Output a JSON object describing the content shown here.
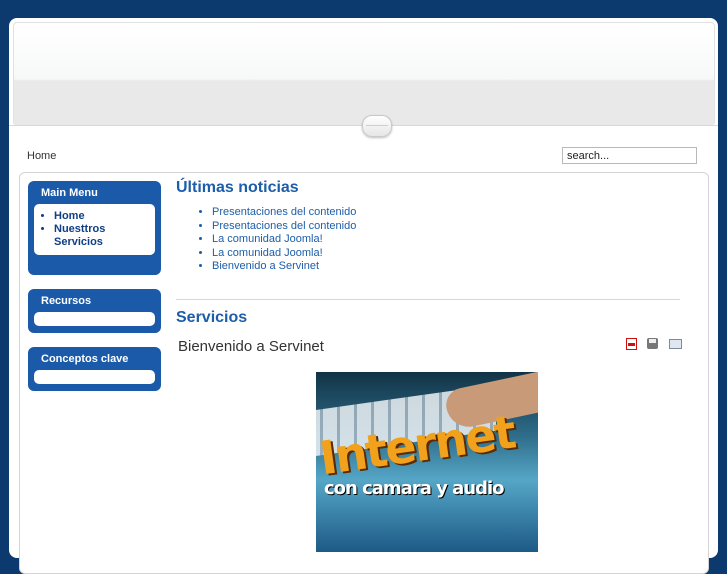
{
  "breadcrumb": "Home",
  "search": {
    "placeholder": "search..."
  },
  "modules": {
    "main_menu": {
      "title": "Main Menu",
      "items": [
        "Home",
        "Nuesttros Servicios"
      ]
    },
    "recursos": {
      "title": "Recursos"
    },
    "conceptos": {
      "title": "Conceptos clave"
    }
  },
  "latest_news": {
    "heading": "Últimas noticias",
    "items": [
      "Presentaciones del contenido",
      "Presentaciones del contenido",
      "La comunidad Joomla!",
      "La comunidad Joomla!",
      "Bienvenido a Servinet"
    ]
  },
  "section": {
    "heading": "Servicios",
    "article_title": "Bienvenido a Servinet",
    "icons": [
      "pdf-icon",
      "print-icon",
      "email-icon"
    ]
  },
  "banner": {
    "line1": "Internet",
    "line2": "con camara y audio"
  },
  "colors": {
    "page_bg": "#0d3a6e",
    "module_bg": "#1b5aa8",
    "link": "#1c5ea9"
  }
}
